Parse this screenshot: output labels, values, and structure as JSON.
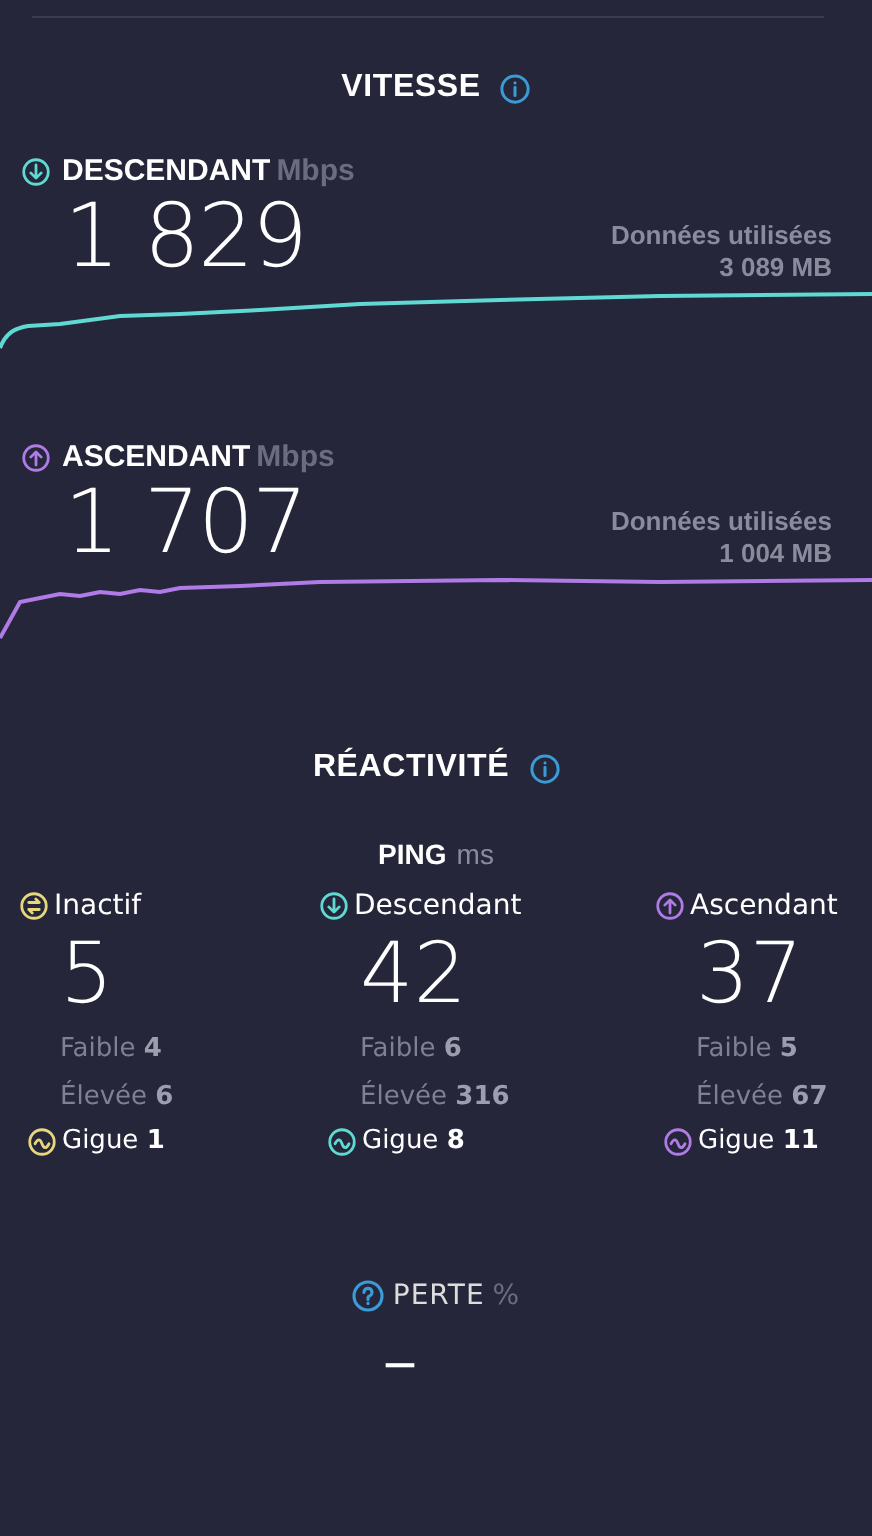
{
  "speed": {
    "title": "VITESSE",
    "measures": [
      {
        "kind": "download",
        "label": "DESCENDANT",
        "unit": "Mbps",
        "value": "1 829",
        "data_label": "Données utilisées",
        "data_value": "3 089 MB"
      },
      {
        "kind": "upload",
        "label": "ASCENDANT",
        "unit": "Mbps",
        "value": "1 707",
        "data_label": "Données utilisées",
        "data_value": "1 004 MB"
      }
    ]
  },
  "responsiveness": {
    "title": "RÉACTIVITÉ",
    "ping_label": "PING",
    "ping_unit": "ms",
    "columns": [
      {
        "kind": "idle",
        "label": "Inactif",
        "value": "5",
        "low_label": "Faible",
        "low": "4",
        "high_label": "Élevée",
        "high": "6",
        "jitter_label": "Gigue",
        "jitter": "1"
      },
      {
        "kind": "download",
        "label": "Descendant",
        "value": "42",
        "low_label": "Faible",
        "low": "6",
        "high_label": "Élevée",
        "high": "316",
        "jitter_label": "Gigue",
        "jitter": "8"
      },
      {
        "kind": "upload",
        "label": "Ascendant",
        "value": "37",
        "low_label": "Faible",
        "low": "5",
        "high_label": "Élevée",
        "high": "67",
        "jitter_label": "Gigue",
        "jitter": "11"
      }
    ]
  },
  "loss": {
    "label": "PERTE",
    "unit": "%",
    "value": "—"
  }
}
